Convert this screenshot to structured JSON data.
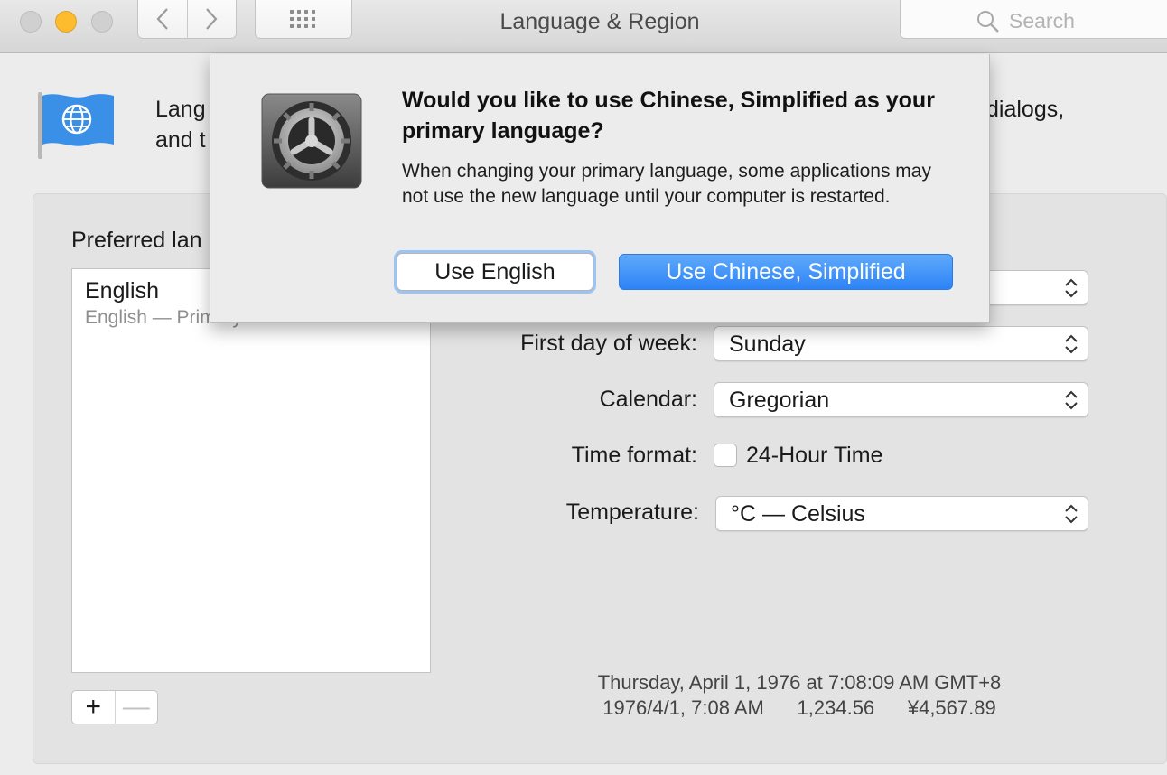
{
  "window": {
    "title": "Language & Region"
  },
  "toolbar": {
    "search_placeholder": "Search"
  },
  "header": {
    "description_line1_start": "Lang",
    "description_line1_end": "dialogs,",
    "description_line2_start": "and t"
  },
  "preferred": {
    "label": "Preferred lan",
    "languages": [
      {
        "name": "English",
        "subtitle": "English — Primary"
      }
    ],
    "add_label": "+",
    "remove_label": "—"
  },
  "settings": {
    "first_day_label": "First day of week:",
    "first_day_value": "Sunday",
    "calendar_label": "Calendar:",
    "calendar_value": "Gregorian",
    "time_format_label": "Time format:",
    "time_format_option": "24-Hour Time",
    "time_format_checked": false,
    "temperature_label": "Temperature:",
    "temperature_value": "°C — Celsius"
  },
  "sample": {
    "line1": "Thursday, April 1, 1976 at 7:08:09 AM GMT+8",
    "line2": "1976/4/1, 7:08 AM      1,234.56      ¥4,567.89"
  },
  "dialog": {
    "message": "Would you like to use Chinese, Simplified as your primary language?",
    "info": "When changing your primary language, some applications may not use the new language until your computer is restarted.",
    "secondary_button": "Use English",
    "primary_button": "Use Chinese, Simplified"
  },
  "colors": {
    "accent": "#2e84f6",
    "minimize": "#fdbc2e",
    "flag": "#3a8fe6"
  }
}
